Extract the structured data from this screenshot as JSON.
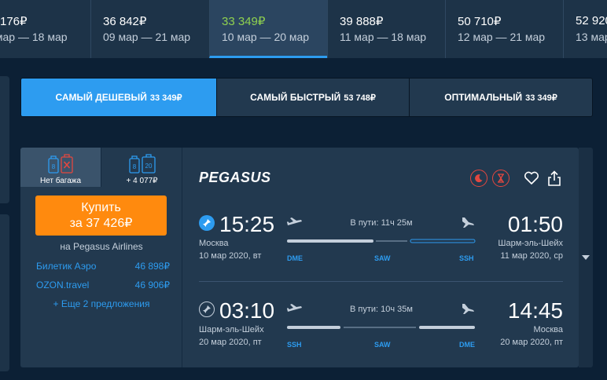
{
  "date_strip": [
    {
      "price": "176₽",
      "range": " мар — 18 мар"
    },
    {
      "price": "36 842₽",
      "range": "09 мар — 21 мар"
    },
    {
      "price": "33 349₽",
      "range": "10 мар — 20 мар"
    },
    {
      "price": "39 888₽",
      "range": "11 мар — 18 мар"
    },
    {
      "price": "50 710₽",
      "range": "12 мар — 21 мар"
    },
    {
      "price": "52 920",
      "range": "13 мар"
    }
  ],
  "sort_tabs": [
    {
      "label": "САМЫЙ ДЕШЕВЫЙ",
      "price": "33 349₽"
    },
    {
      "label": "САМЫЙ БЫСТРЫЙ",
      "price": "53 748₽"
    },
    {
      "label": "ОПТИМАЛЬНЫЙ",
      "price": "33 349₽"
    }
  ],
  "baggage": {
    "option1_label": "Нет багажа",
    "option1_hand": "8",
    "option2_label": "+ 4 077₽",
    "option2_hand": "8",
    "option2_bag": "20"
  },
  "buy": {
    "line1": "Купить",
    "line2": "за 37 426₽",
    "airline": "на Pegasus Airlines"
  },
  "agencies": [
    {
      "name": "Билетик Аэро",
      "price": "46 898₽"
    },
    {
      "name": "OZON.travel",
      "price": "46 906₽"
    }
  ],
  "more_offers": "+ Еще 2 предложения",
  "airline_logo": "PEGASUS",
  "icons": {
    "night": "moon-icon",
    "long_layover": "hourglass-icon",
    "favorite": "heart-icon",
    "share": "share-icon"
  },
  "segments": [
    {
      "dep_time": "15:25",
      "arr_time": "01:50",
      "dep_city": "Москва",
      "arr_city": "Шарм-эль-Шейх",
      "dep_date": "10 мар 2020, вт",
      "arr_date": "11 мар 2020, ср",
      "duration": "В пути: 11ч 25м",
      "codes": [
        "DME",
        "SAW",
        "SSH"
      ]
    },
    {
      "dep_time": "03:10",
      "arr_time": "14:45",
      "dep_city": "Шарм-эль-Шейх",
      "arr_city": "Москва",
      "dep_date": "20 мар 2020, пт",
      "arr_date": "20 мар 2020, пт",
      "duration": "В пути: 10ч 35м",
      "codes": [
        "SSH",
        "SAW",
        "DME"
      ]
    }
  ],
  "colors": {
    "accent": "#2d9cf0",
    "buy": "#ff8a0e",
    "active_price": "#8fd14f",
    "warning": "#e4473f"
  }
}
